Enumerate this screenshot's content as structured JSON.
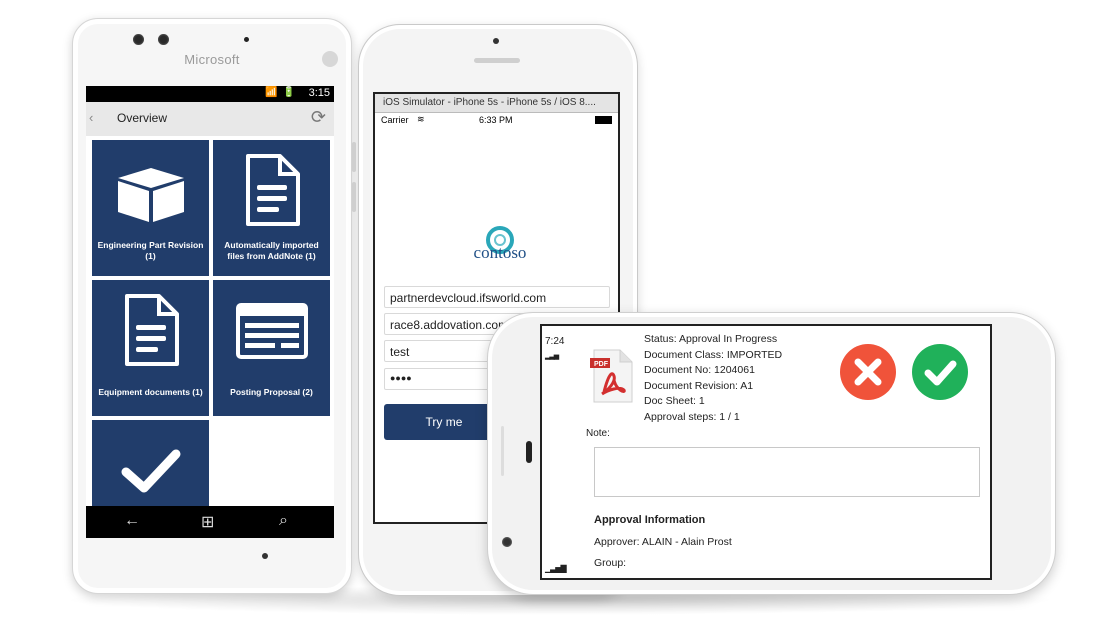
{
  "windows_phone": {
    "brand": "Microsoft",
    "status_time": "3:15",
    "status_icons": "📶 🔋",
    "header_title": "Overview",
    "tiles": [
      {
        "label": "Engineering Part Revision (1)",
        "icon": "box-icon"
      },
      {
        "label": "Automatically imported files from AddNote (1)",
        "icon": "document-icon"
      },
      {
        "label": "Equipment documents (1)",
        "icon": "document-icon"
      },
      {
        "label": "Posting Proposal (2)",
        "icon": "table-icon"
      },
      {
        "label": "",
        "icon": "checkmark-icon"
      }
    ],
    "nav": {
      "back": "←",
      "start": "⊞",
      "search": "⌕"
    }
  },
  "iphone": {
    "window_title": "iOS Simulator - iPhone 5s - iPhone 5s / iOS 8....",
    "carrier": "Carrier",
    "time": "6:33 PM",
    "logo_text": "contoso",
    "inputs": {
      "server": "partnerdevcloud.ifsworld.com",
      "database": "race8.addovation.com",
      "username": "test",
      "password": "●●●●"
    },
    "button_label": "Try me"
  },
  "landscape": {
    "time": "7:24",
    "status": "Status: Approval In Progress",
    "doc_class": "Document Class: IMPORTED",
    "doc_no": "Document No: 1204061",
    "doc_rev": "Document Revision: A1",
    "doc_sheet": "Doc Sheet: 1",
    "approval_steps": "Approval steps: 1 / 1",
    "note_label": "Note:",
    "approval_heading": "Approval Information",
    "approver": "Approver: ALAIN - Alain Prost",
    "group": "Group:",
    "colors": {
      "reject": "#f0533a",
      "approve": "#20b15a"
    }
  }
}
